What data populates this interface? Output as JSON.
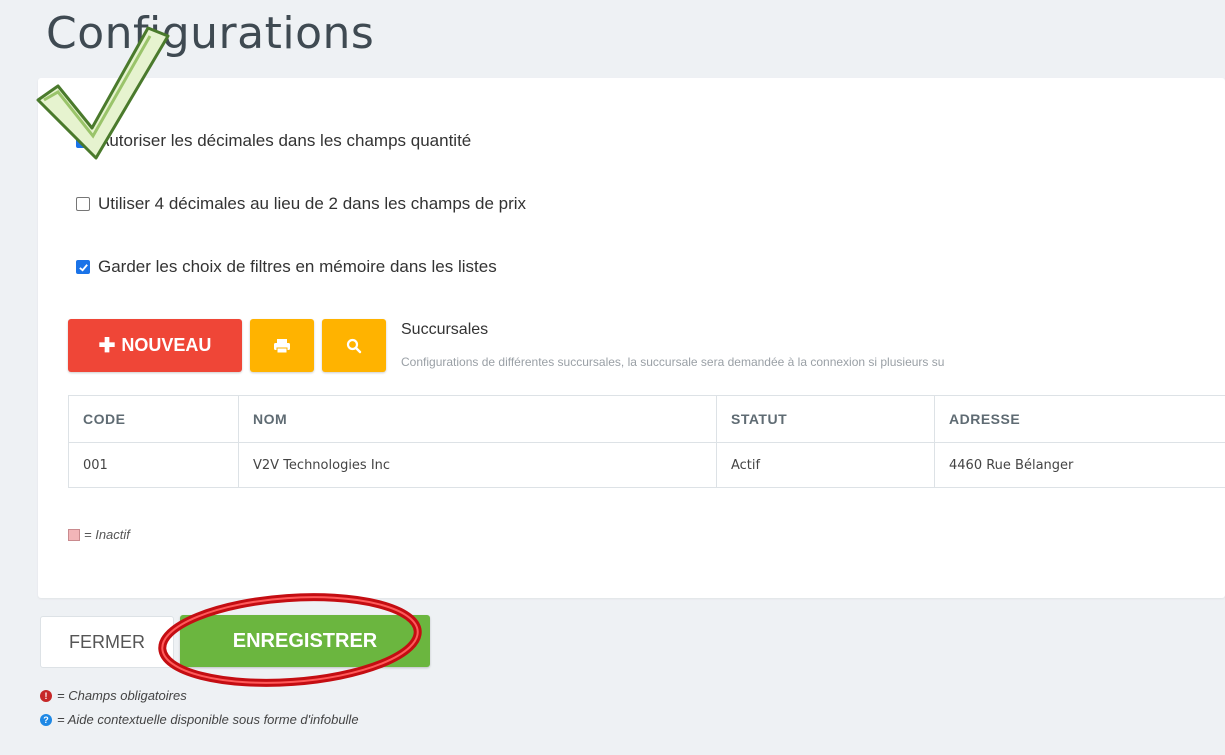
{
  "page": {
    "title": "Configurations"
  },
  "options": [
    {
      "label": "Autoriser les décimales dans les champs quantité",
      "checked": true
    },
    {
      "label": "Utiliser 4 décimales au lieu de 2 dans les champs de prix",
      "checked": false
    },
    {
      "label": "Garder les choix de filtres en mémoire dans les listes",
      "checked": true
    }
  ],
  "toolbar": {
    "new_label": "NOUVEAU",
    "new_icon": "plus-icon",
    "print_icon": "print-icon",
    "search_icon": "search-icon"
  },
  "section": {
    "title": "Succursales",
    "description": "Configurations de différentes succursales, la succursale sera demandée à la connexion si plusieurs su"
  },
  "table": {
    "columns": [
      "CODE",
      "NOM",
      "STATUT",
      "ADRESSE"
    ],
    "rows": [
      [
        "001",
        "V2V Technologies Inc",
        "Actif",
        "4460 Rue Bélanger"
      ]
    ]
  },
  "legend": {
    "inactive_label": "= Inactif"
  },
  "footer": {
    "close_label": "FERMER",
    "save_label": "ENREGISTRER",
    "required_note": "= Champs obligatoires",
    "help_note": "= Aide contextuelle disponible sous forme d'infobulle"
  },
  "colors": {
    "new_button": "#ef4637",
    "tool_buttons": "#ffb300",
    "save_button": "#6bb63f",
    "checkbox": "#1a73e8",
    "required_icon": "#c62828",
    "help_icon": "#1e88e5"
  }
}
